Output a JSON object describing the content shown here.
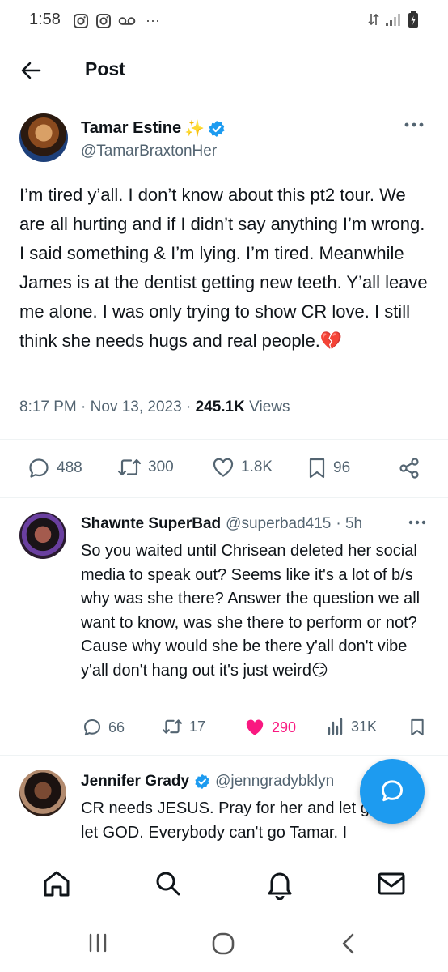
{
  "status_bar": {
    "time": "1:58",
    "notif_icons": [
      "instagram-icon",
      "instagram-icon",
      "voicemail-icon"
    ],
    "more": "···"
  },
  "header": {
    "title": "Post"
  },
  "post": {
    "author_name": "Tamar Estine",
    "author_emoji": "✨",
    "handle": "@TamarBraxtonHer",
    "text": "I’m tired y’all. I don’t know about this pt2 tour. We are all hurting and if I didn’t say anything I’m wrong. I said something & I’m lying. I’m tired. Meanwhile James is at the dentist getting new teeth. Y’all leave me alone. I was only trying to show CR love. I still think she needs hugs and real people.💔",
    "time": "8:17 PM",
    "date": "Nov 13, 2023",
    "views_count": "245.1K",
    "views_label": "Views",
    "stats": {
      "replies": "488",
      "reposts": "300",
      "likes": "1.8K",
      "bookmarks": "96"
    }
  },
  "replies": [
    {
      "name": "Shawnte SuperBad",
      "handle": "@superbad415",
      "time": "· 5h",
      "text": "So you waited until Chrisean deleted her social media to speak out? Seems like it's a lot of b/s why was she there? Answer the question we all want to know, was she there to perform or not? Cause why would she be there y'all don't vibe y'all don't hang out it's just weird😏",
      "replies": "66",
      "reposts": "17",
      "likes": "290",
      "views": "31K"
    },
    {
      "name": "Jennifer Grady",
      "handle": "@jenngradybklyn",
      "text": "CR needs JESUS. Pray for her and let go and let GOD. Everybody can't go Tamar. I"
    }
  ],
  "colors": {
    "accent": "#1d9bf0",
    "like": "#f91880",
    "secondary_text": "#536471"
  }
}
